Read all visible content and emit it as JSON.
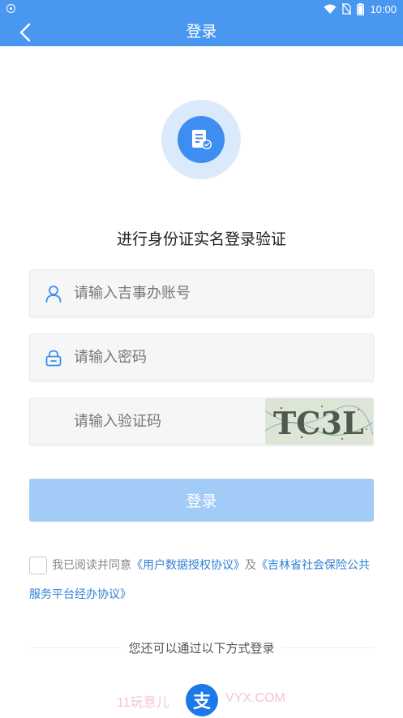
{
  "status_bar": {
    "time": "10:00"
  },
  "nav": {
    "title": "登录"
  },
  "subtitle": "进行身份证实名登录验证",
  "form": {
    "account_placeholder": "请输入吉事办账号",
    "password_placeholder": "请输入密码",
    "captcha_placeholder": "请输入验证码",
    "captcha_text": "TC3L",
    "login_label": "登录"
  },
  "agreement": {
    "prefix": "我已阅读并同意",
    "link1": "《用户数据授权协议》",
    "conj": "及",
    "link2_part1": "《吉林省社会保险公共",
    "link2_part2": "服务平台经办协议》"
  },
  "alt_login": {
    "label": "您还可以通过以下方式登录",
    "alipay_glyph": "支"
  },
  "watermark": {
    "left": "11玩意儿",
    "right": "VYX.COM"
  },
  "colors": {
    "brand": "#4a97f2",
    "button_disabled": "#a3cbf8",
    "link": "#2f7fd6"
  }
}
